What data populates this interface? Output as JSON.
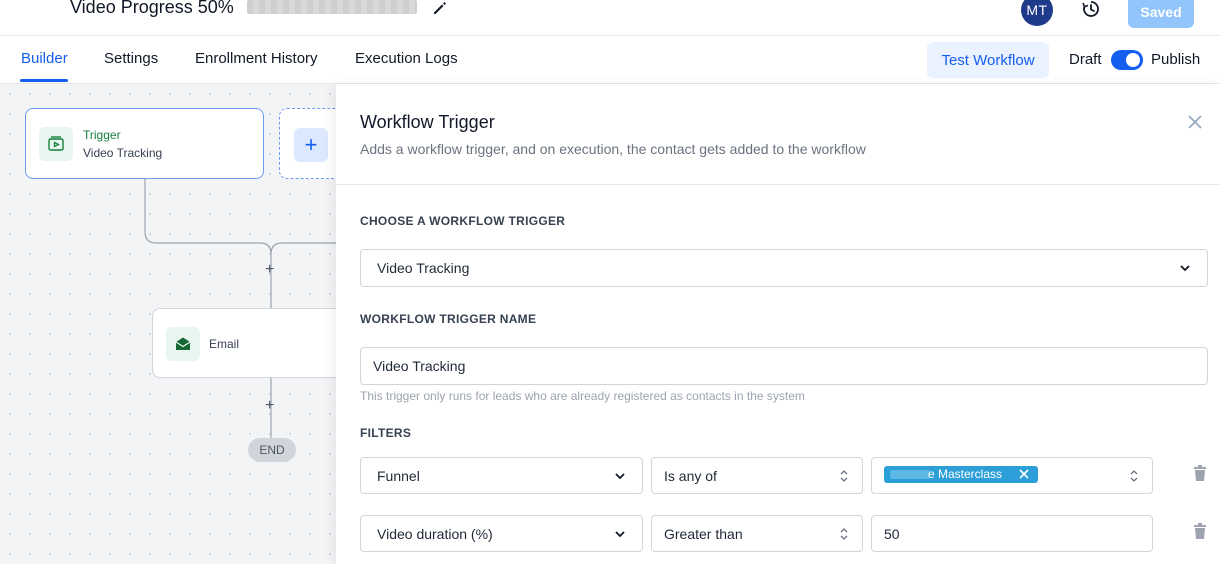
{
  "header": {
    "title": "Video Progress 50%",
    "avatar_initials": "MT",
    "saved_label": "Saved"
  },
  "tabs": {
    "items": [
      "Builder",
      "Settings",
      "Enrollment History",
      "Execution Logs"
    ],
    "active": "Builder",
    "test_workflow_label": "Test Workflow",
    "draft_label": "Draft",
    "publish_label": "Publish",
    "publish_enabled": true
  },
  "canvas": {
    "trigger_node": {
      "title": "Trigger",
      "subtitle": "Video Tracking"
    },
    "add_node_symbol": "+",
    "email_node": {
      "label": "Email"
    },
    "end_label": "END"
  },
  "panel": {
    "title": "Workflow Trigger",
    "description": "Adds a workflow trigger, and on execution, the contact gets added to the workflow",
    "choose_trigger_label": "CHOOSE A WORKFLOW TRIGGER",
    "trigger_select_value": "Video Tracking",
    "trigger_name_label": "WORKFLOW TRIGGER NAME",
    "trigger_name_value": "Video Tracking",
    "trigger_hint": "This trigger only runs for leads who are already registered as contacts in the system",
    "filters_label": "FILTERS",
    "filters": [
      {
        "field": "Funnel",
        "operator": "Is any of",
        "value_chip": "e Masterclass"
      },
      {
        "field": "Video duration (%)",
        "operator": "Greater than",
        "value": "50"
      }
    ]
  },
  "colors": {
    "accent": "#155eef",
    "node_green": "#15803d",
    "saved_button": "#93c5fd",
    "avatar": "#1e3a8a",
    "chip": "#2d9fd8"
  },
  "icons": [
    "edit-icon",
    "history-icon",
    "video-icon",
    "plus-icon",
    "mail-icon",
    "close-icon",
    "chevron-down-icon",
    "updown-icon",
    "trash-icon"
  ]
}
